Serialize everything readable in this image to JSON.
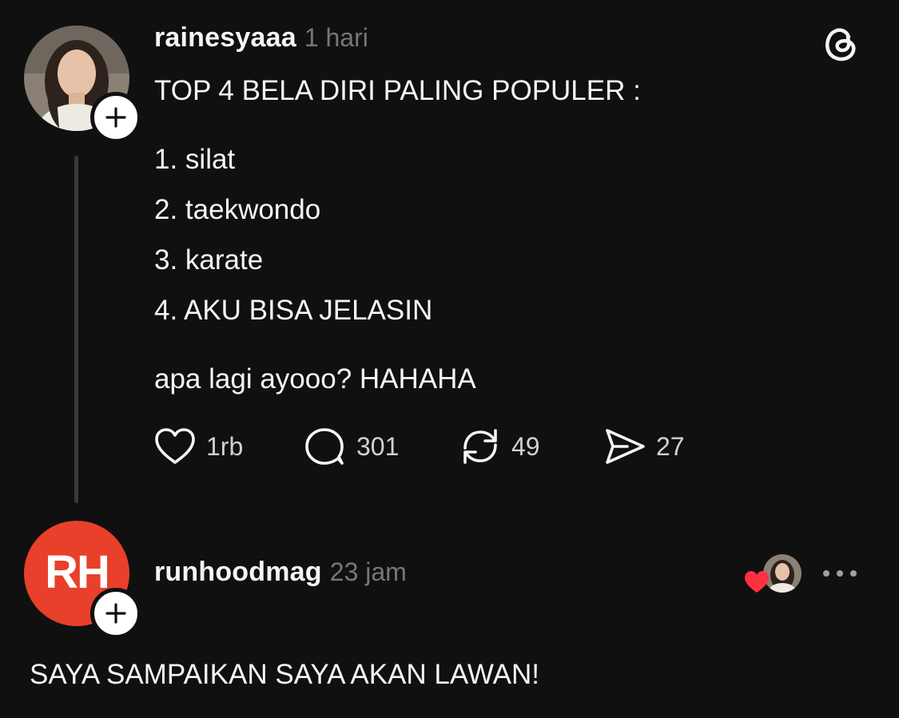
{
  "post": {
    "username": "rainesyaaa",
    "time": "1 hari",
    "title_line": "TOP 4 BELA DIRI PALING POPULER :",
    "list": [
      "1. silat",
      "2. taekwondo",
      "3. karate",
      "4. AKU BISA JELASIN"
    ],
    "closing": "apa lagi ayooo? HAHAHA",
    "actions": {
      "likes": "1rb",
      "replies": "301",
      "reposts": "49",
      "shares": "27"
    }
  },
  "reply": {
    "username": "runhoodmag",
    "time": "23 jam",
    "avatar_text": "RH",
    "text": "SAYA SAMPAIKAN SAYA AKAN LAWAN!"
  },
  "icons": {
    "app_logo": "threads-logo-icon",
    "like": "heart-icon",
    "reply": "comment-bubble-icon",
    "repost": "repost-icon",
    "share": "send-icon",
    "follow": "plus-icon",
    "more": "more-dots-icon",
    "liked_by_author": "red-heart-icon"
  },
  "colors": {
    "background": "#101010",
    "text": "#f3f5f7",
    "muted": "#777777",
    "brand_red": "#e8402a",
    "like_red": "#ff3040"
  }
}
